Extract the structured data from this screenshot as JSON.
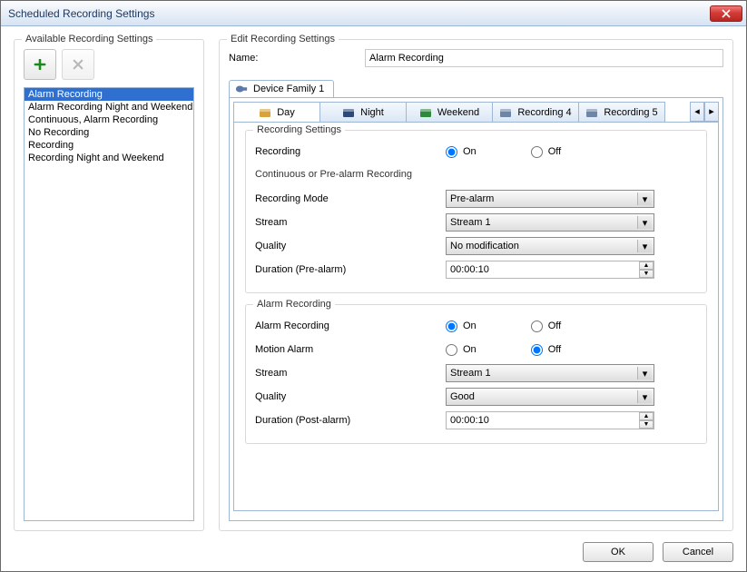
{
  "window_title": "Scheduled Recording Settings",
  "left": {
    "legend": "Available Recording Settings",
    "items": [
      "Alarm Recording",
      "Alarm Recording Night and Weekend",
      "Continuous, Alarm Recording",
      "No Recording",
      "Recording",
      "Recording Night and Weekend"
    ],
    "selected_index": 0
  },
  "right": {
    "legend": "Edit Recording Settings",
    "name_label": "Name:",
    "name_value": "Alarm Recording",
    "device_tab": "Device Family 1",
    "inner_tabs": [
      "Day",
      "Night",
      "Weekend",
      "Recording 4",
      "Recording 5"
    ],
    "inner_active": 0,
    "recording_settings": {
      "legend": "Recording Settings",
      "recording_label": "Recording",
      "recording_on": "On",
      "recording_off": "Off",
      "recording_value": "On",
      "subhead": "Continuous or Pre-alarm Recording",
      "mode_label": "Recording Mode",
      "mode_value": "Pre-alarm",
      "stream_label": "Stream",
      "stream_value": "Stream 1",
      "quality_label": "Quality",
      "quality_value": "No modification",
      "duration_label": "Duration (Pre-alarm)",
      "duration_value": "00:00:10"
    },
    "alarm_recording": {
      "legend": "Alarm Recording",
      "alarm_label": "Alarm Recording",
      "alarm_value": "On",
      "motion_label": "Motion Alarm",
      "motion_value": "Off",
      "on": "On",
      "off": "Off",
      "stream_label": "Stream",
      "stream_value": "Stream 1",
      "quality_label": "Quality",
      "quality_value": "Good",
      "duration_label": "Duration (Post-alarm)",
      "duration_value": "00:00:10"
    }
  },
  "footer": {
    "ok": "OK",
    "cancel": "Cancel"
  }
}
